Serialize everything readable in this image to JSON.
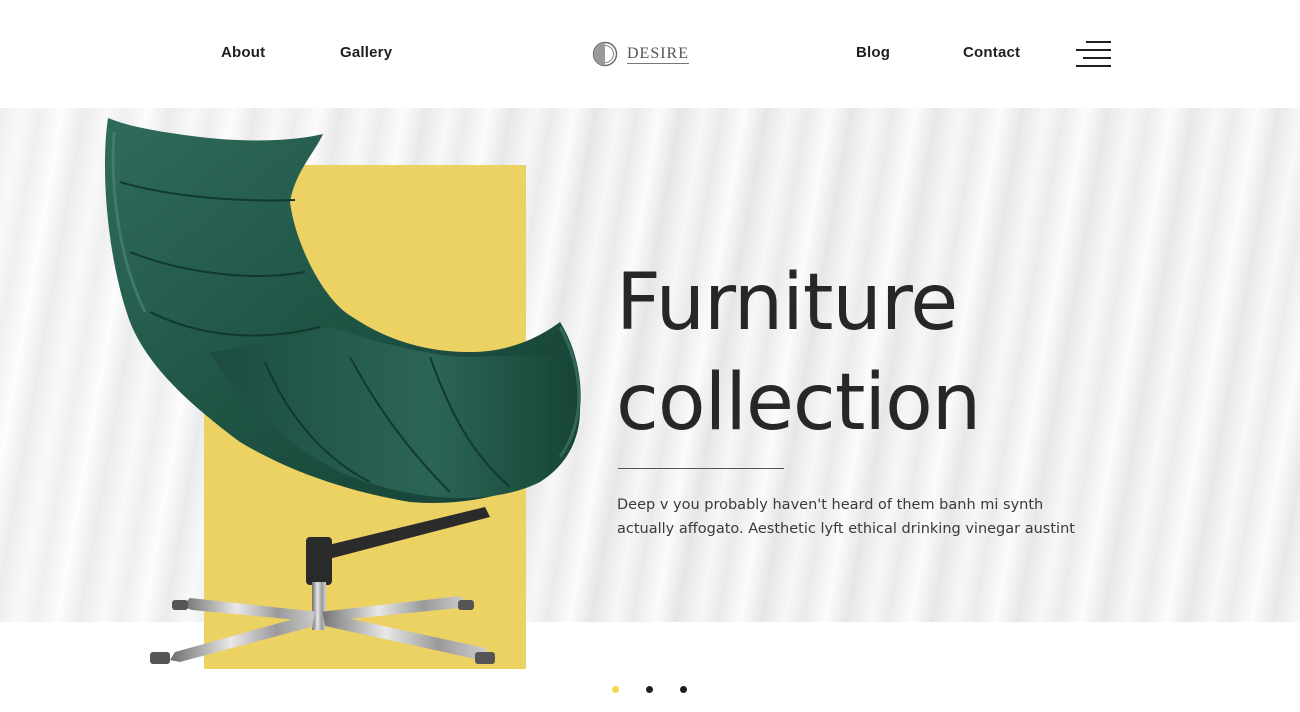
{
  "nav": {
    "left": [
      "About",
      "Gallery"
    ],
    "right": [
      "Blog",
      "Contact"
    ]
  },
  "logo": {
    "text": "DESIRE",
    "icon": "half-circle-logo-icon"
  },
  "menu": {
    "icon": "hamburger-menu-icon"
  },
  "hero": {
    "title_line1": "Furniture",
    "title_line2": "collection",
    "description": "Deep v you probably haven't heard of them banh mi synth actually affogato. Aesthetic lyft ethical drinking vinegar austint",
    "image": "green-lounge-chair-image",
    "accent_color": "#ecd163"
  },
  "slider": {
    "count": 3,
    "active_index": 0,
    "active_color": "#f1d94b",
    "inactive_color": "#1f1f1f"
  }
}
